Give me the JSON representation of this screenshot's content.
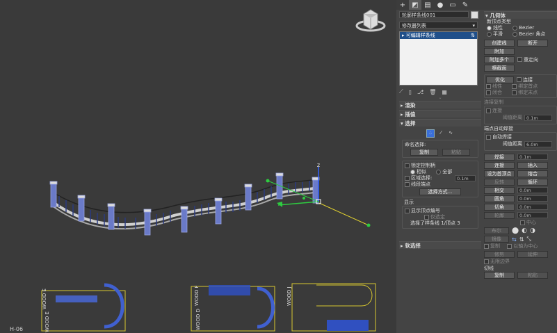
{
  "viewport": {
    "drawing_labels": [
      "WOOD E",
      "WOOD E",
      "WOOD F",
      "WOOD D",
      "WOOD J",
      "H-06"
    ]
  },
  "toolbar_tabs": [
    {
      "icon": "plus-icon",
      "active": false
    },
    {
      "icon": "modify-icon",
      "active": true
    },
    {
      "icon": "hierarchy-icon",
      "active": false
    },
    {
      "icon": "motion-icon",
      "active": false
    },
    {
      "icon": "display-icon",
      "active": false
    },
    {
      "icon": "utilities-icon",
      "active": false
    }
  ],
  "object_name": "轮廓样条线001",
  "modifier_list_label": "修改器列表",
  "modifier_stack": [
    "可编辑样条线"
  ],
  "left_sections": {
    "render": "渲染",
    "interp": "插值",
    "select": "选择",
    "soft_select": "软选择"
  },
  "named_selection": {
    "title": "命名选择:",
    "copy": "复制",
    "paste": "粘贴"
  },
  "select_opts": {
    "lock_handles": "锁定控制柄",
    "alike": "相似",
    "all": "全部",
    "area_select": "区域选择:",
    "area_value": "0.1m",
    "segment_end": "线段端点",
    "select_by": "选择方式..."
  },
  "display": {
    "title": "显示",
    "show_numbers": "显示顶点编号",
    "selected_only": "仅选定",
    "status": "选择了样条线 1/顶点 3"
  },
  "geometry": {
    "title": "几何体",
    "new_vertex_type": "新顶点类型",
    "linear": "线性",
    "bezier": "Bezier",
    "smooth": "平滑",
    "bezier_corner": "Bezier 角点",
    "create_line": "创建线",
    "break": "断开",
    "attach": "附加",
    "attach_mult": "附加多个",
    "reorient": "重定向",
    "cross_section": "横截面",
    "refine": "优化",
    "connect": "连接",
    "linear2": "线性",
    "bind_first": "绑定首点",
    "closed": "闭合",
    "bind_last": "绑定末点",
    "connect_copy": "连接复制",
    "connect_label": "连接",
    "threshold_label": "阈值距离",
    "threshold_value": "0.1m",
    "end_auto_weld": "端点自动焊接",
    "auto_weld": "自动焊接",
    "threshold2_label": "阈值距离",
    "threshold2_value": "6.0m",
    "weld": "焊接",
    "weld_value": "0.1m",
    "connect_btn": "连接",
    "insert": "插入",
    "make_first": "设为首顶点",
    "fuse": "熔合",
    "reverse": "反转",
    "cycle": "循环",
    "crossinsert": "相交",
    "crossinsert_value": "0.0m",
    "fillet": "圆角",
    "fillet_value": "0.0m",
    "chamfer": "切角",
    "chamfer_value": "0.0m",
    "outline": "轮廓",
    "outline_value": "0.0m",
    "center": "中心",
    "boolean": "布尔",
    "mirror": "镜像",
    "copy": "复制",
    "about_pivot": "以轴为中心",
    "trim": "修剪",
    "extend": "延伸",
    "infinite_bounds": "无限边界",
    "tangent": "切线",
    "tan_copy": "复制",
    "tan_paste": "粘贴"
  }
}
